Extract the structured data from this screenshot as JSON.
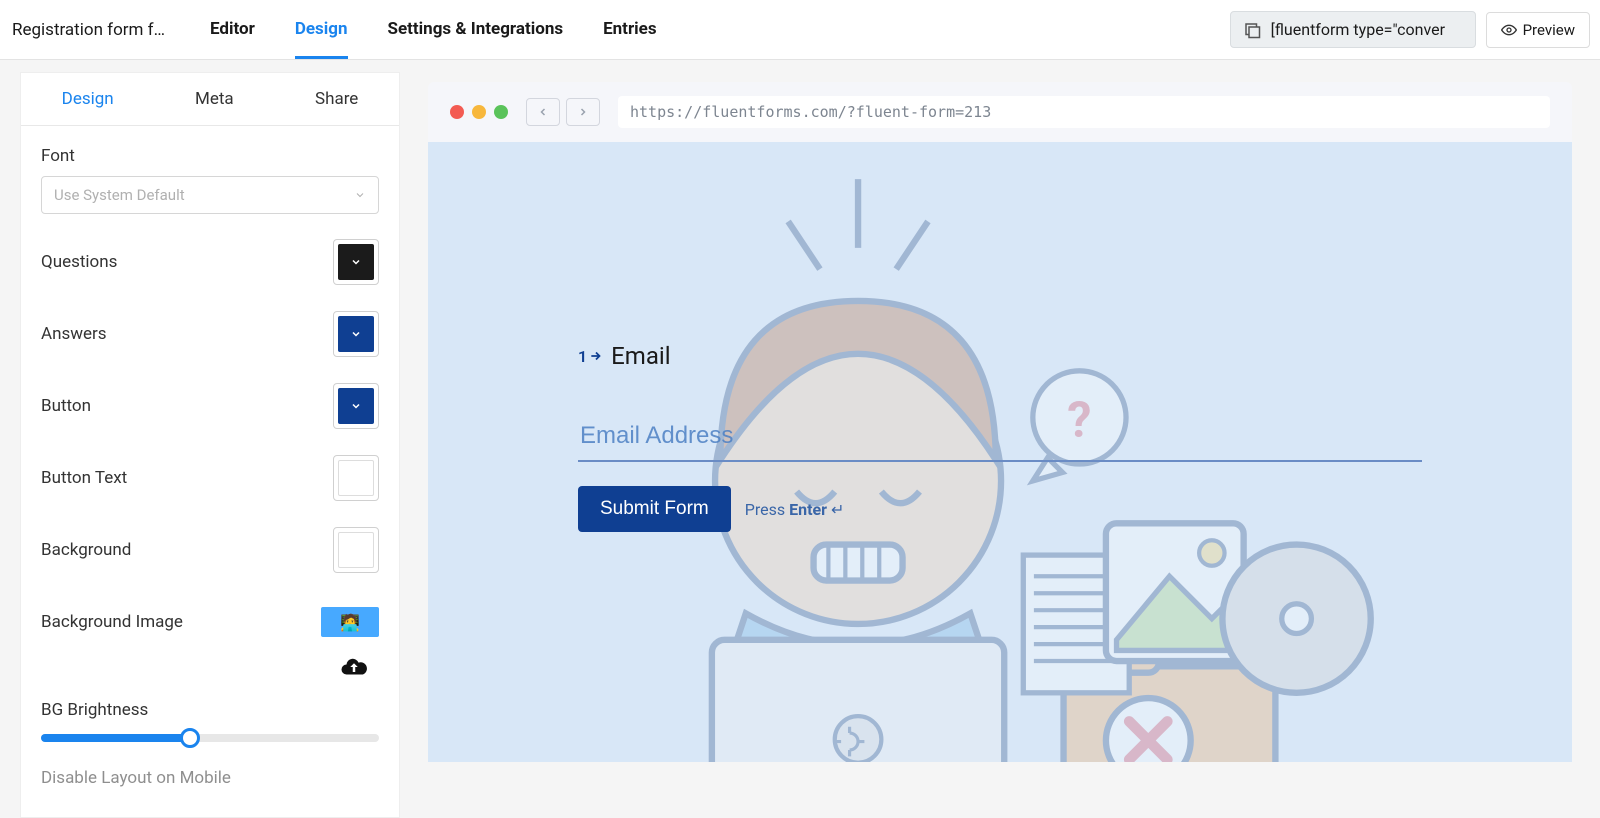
{
  "header": {
    "title": "Registration form f…",
    "tabs": [
      "Editor",
      "Design",
      "Settings & Integrations",
      "Entries"
    ],
    "active_tab": "Design",
    "shortcode": "[fluentform type=\"conver",
    "preview_label": "Preview"
  },
  "sidebar": {
    "tabs": [
      "Design",
      "Meta",
      "Share"
    ],
    "active_tab": "Design",
    "font": {
      "label": "Font",
      "placeholder": "Use System Default"
    },
    "colors": {
      "questions": {
        "label": "Questions",
        "value": "#1b1b1b"
      },
      "answers": {
        "label": "Answers",
        "value": "#0f3f92"
      },
      "button": {
        "label": "Button",
        "value": "#0f3f92"
      },
      "button_text": {
        "label": "Button Text",
        "value": "#ffffff"
      },
      "background": {
        "label": "Background",
        "value": "#ffffff"
      }
    },
    "bg_image": {
      "label": "Background Image"
    },
    "brightness": {
      "label": "BG Brightness",
      "value": 44
    },
    "disable_mobile": "Disable Layout on Mobile"
  },
  "preview": {
    "url": "https://fluentforms.com/?fluent-form=213",
    "question_number": "1",
    "question_label": "Email",
    "email_placeholder": "Email Address",
    "submit_label": "Submit Form",
    "press_text": "Press ",
    "enter_text": "Enter",
    "enter_arrow": " ↵"
  }
}
